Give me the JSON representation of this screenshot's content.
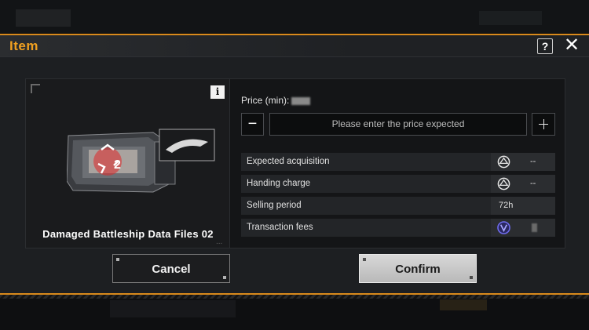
{
  "dialog": {
    "title": "Item",
    "help_label": "?",
    "close_label": "✕"
  },
  "item": {
    "name": "Damaged Battleship Data Files 02",
    "info_label": "i",
    "art_number": "2",
    "more_label": "..."
  },
  "price": {
    "label": "Price (min):",
    "placeholder": "Please enter the price expected",
    "minus_label": "−"
  },
  "details": [
    {
      "label": "Expected acquisition",
      "icon": "currency-icon",
      "value": "--"
    },
    {
      "label": "Handing charge",
      "icon": "currency-icon",
      "value": "--"
    },
    {
      "label": "Selling period",
      "value": "72h"
    },
    {
      "label": "Transaction fees",
      "icon": "v-token-icon",
      "value": ""
    }
  ],
  "buttons": {
    "cancel": "Cancel",
    "confirm": "Confirm"
  },
  "colors": {
    "accent": "#f0a020",
    "frame": "#d98a1c",
    "token": "#6f6cf0"
  }
}
